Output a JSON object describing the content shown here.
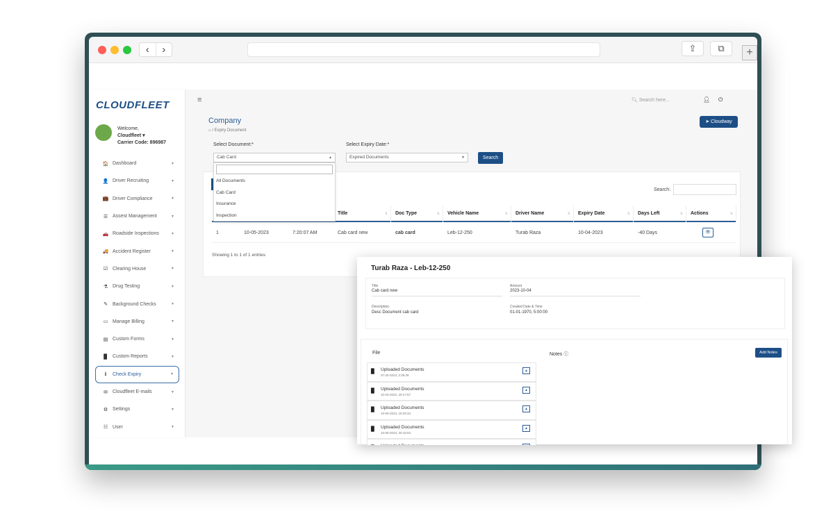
{
  "app": {
    "logo": "CLOUDFLEET",
    "welcome": "Welcome,",
    "user_name": "Cloudfleet ▾",
    "carrier_code": "Carrier Code: 896987",
    "search_placeholder": "Search here..."
  },
  "sidebar": {
    "items": [
      {
        "icon": "home-icon",
        "glyph": "🏠",
        "label": "Dashboard"
      },
      {
        "icon": "user-icon",
        "glyph": "👤",
        "label": "Driver Recruiting"
      },
      {
        "icon": "briefcase-icon",
        "glyph": "💼",
        "label": "Driver Compliance"
      },
      {
        "icon": "list-icon",
        "glyph": "☰",
        "label": "Assest Management"
      },
      {
        "icon": "car-icon",
        "glyph": "🚗",
        "label": "Roadside Inspections"
      },
      {
        "icon": "truck-icon",
        "glyph": "🚚",
        "label": "Accident Register"
      },
      {
        "icon": "check-icon",
        "glyph": "☑",
        "label": "Clearing House"
      },
      {
        "icon": "flask-icon",
        "glyph": "⚗",
        "label": "Drug Testing"
      },
      {
        "icon": "edit-icon",
        "glyph": "✎",
        "label": "Background Checks"
      },
      {
        "icon": "card-icon",
        "glyph": "▭",
        "label": "Manage Billing"
      },
      {
        "icon": "forms-icon",
        "glyph": "▤",
        "label": "Custom Forms"
      },
      {
        "icon": "file-icon",
        "glyph": "▉",
        "label": "Custom Reports"
      },
      {
        "icon": "info-icon",
        "glyph": "ℹ",
        "label": "Check Expiry",
        "active": true
      },
      {
        "icon": "mail-icon",
        "glyph": "✉",
        "label": "Cloudfleet E-mails"
      },
      {
        "icon": "gear-icon",
        "glyph": "⚙",
        "label": "Settings"
      },
      {
        "icon": "users-icon",
        "glyph": "☷",
        "label": "User"
      }
    ]
  },
  "page": {
    "title": "Company",
    "breadcrumb": "Expiry Document",
    "cloudway_label": "Cloudway",
    "select_document_label": "Select Document:*",
    "select_document_value": "Cab Card",
    "select_expiry_label": "Select Expiry Date:*",
    "select_expiry_value": "Expired Documents",
    "search_button": "Search",
    "dropdown_options": [
      "All Documents",
      "Cab Card",
      "Insurance",
      "Inspection"
    ],
    "table_search_label": "Search:",
    "showing": "Showing 1 to 1 of 1 entries"
  },
  "table": {
    "headers": [
      "Title",
      "Doc Type",
      "Vehicle Name",
      "Driver Name",
      "Expiry Date",
      "Days Left",
      "Actions"
    ],
    "rows": [
      [
        "1",
        "10-05-2023",
        "7:20:07 AM",
        "Cab card new",
        "cab card",
        "Leb-12-250",
        "Turab Raza",
        "10-04-2023",
        "-40 Days"
      ]
    ]
  },
  "modal": {
    "title": "Turab Raza - Leb-12-250",
    "fields": {
      "title_label": "Title",
      "title_value": "Cab card new",
      "amount_label": "Amount",
      "amount_value": "2023-10-04",
      "description_label": "Description",
      "description_value": "Desc Document cab card",
      "created_label": "Created Date & Time",
      "created_value": "01-01-1970, 5:00:00"
    },
    "file_label": "File",
    "notes_label": "Notes ⓘ",
    "add_notes": "Add Notes",
    "files": [
      {
        "name": "Uploaded Documents",
        "date": "07-20-2023, 2:36:28"
      },
      {
        "name": "Uploaded Documents",
        "date": "10-03-2023, 20:17:57"
      },
      {
        "name": "Uploaded Documents",
        "date": "10-05-2023, 19:29:34"
      },
      {
        "name": "Uploaded Documents",
        "date": "10-05-2023, 20:15:53"
      },
      {
        "name": "Uploaded Documents",
        "date": ""
      }
    ]
  }
}
